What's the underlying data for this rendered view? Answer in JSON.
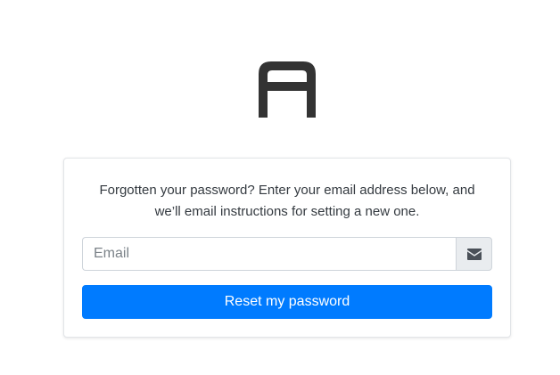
{
  "logo": {
    "icon": "app-logo-a-icon",
    "color": "#333333"
  },
  "card": {
    "message": "Forgotten your password? Enter your email address below, and we’ll email instructions for setting a new one.",
    "email": {
      "value": "",
      "placeholder": "Email",
      "icon": "envelope-icon"
    },
    "submit_label": "Reset my password"
  },
  "colors": {
    "primary": "#007bff",
    "addon_bg": "#e9ecef",
    "border": "#ced4da"
  }
}
